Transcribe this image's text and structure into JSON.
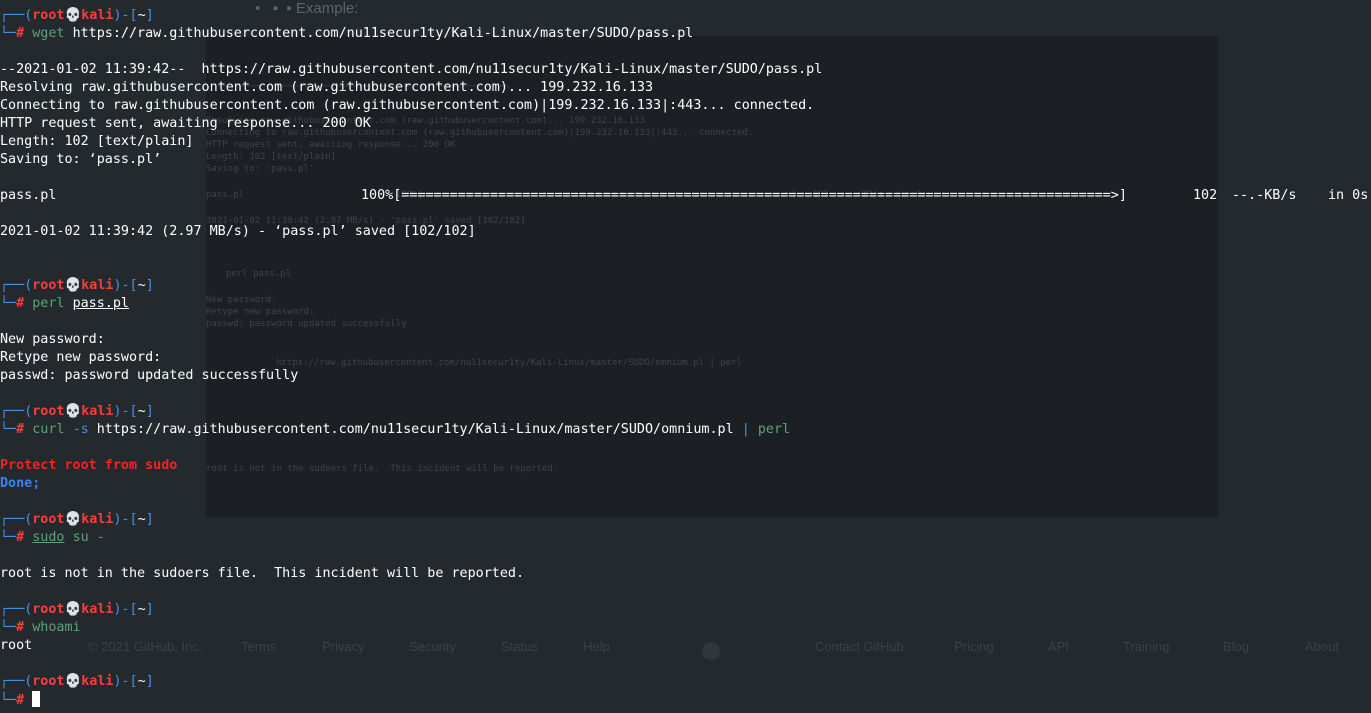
{
  "prompt": {
    "prefix_top": "┌──",
    "open": "(",
    "user": "root",
    "skull": "💀",
    "host": "kali",
    "close": ")-[",
    "dir": "~",
    "dir_close": "]",
    "prefix_bottom": "└─",
    "hash": "#"
  },
  "commands": {
    "wget": {
      "cmd": "wget",
      "arg": "https://raw.githubusercontent.com/nu11secur1ty/Kali-Linux/master/SUDO/pass.pl",
      "output": [
        "",
        "--2021-01-02 11:39:42--  https://raw.githubusercontent.com/nu11secur1ty/Kali-Linux/master/SUDO/pass.pl",
        "Resolving raw.githubusercontent.com (raw.githubusercontent.com)... 199.232.16.133",
        "Connecting to raw.githubusercontent.com (raw.githubusercontent.com)|199.232.16.133|:443... connected.",
        "HTTP request sent, awaiting response... 200 OK",
        "Length: 102 [text/plain]",
        "Saving to: ‘pass.pl’",
        ""
      ],
      "progress": {
        "filename": "pass.pl",
        "percent_bar": "100%[========================================================================================>]",
        "size": "102",
        "rate": "--.-KB/s",
        "time": "in 0s"
      },
      "saved": "2021-01-02 11:39:42 (2.97 MB/s) - ‘pass.pl’ saved [102/102]"
    },
    "perl": {
      "cmd": "perl",
      "arg": "pass.pl",
      "output": [
        "",
        "New password:",
        "Retype new password:",
        "passwd: password updated successfully"
      ]
    },
    "curl": {
      "cmd": "curl",
      "opt": "-s",
      "arg": "https://raw.githubusercontent.com/nu11secur1ty/Kali-Linux/master/SUDO/omnium.pl",
      "pipe": "|",
      "pipe_cmd": "perl",
      "err_line": "Protect root from sudo",
      "done_line": "Done;"
    },
    "sudo": {
      "cmd": "sudo",
      "arg": "su -",
      "output": "root is not in the sudoers file.  This incident will be reported."
    },
    "whoami": {
      "cmd": "whoami",
      "output": "root"
    }
  },
  "ghost": {
    "bullet_text": "•   ▪  ▪ Example:",
    "footer_items": [
      "© 2021 GitHub, Inc.",
      "Terms",
      "Privacy",
      "Security",
      "Status",
      "Help",
      "Contact GitHub",
      "Pricing",
      "API",
      "Training",
      "Blog",
      "About"
    ]
  }
}
